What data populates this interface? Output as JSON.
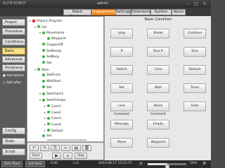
{
  "titlebar": {
    "logo": "ELITE ROBOT",
    "user": "admin"
  },
  "menu": [
    "Robot Teaching",
    "Programming",
    "Settings",
    "Extensions",
    "System Info",
    "About"
  ],
  "left": {
    "project": "Project",
    "procedure": "Procedure",
    "conditions": "Conditions",
    "basic": "Basic",
    "advanced": "Advanced",
    "peripheral": "Peripheral",
    "add_before": "Add before",
    "add_after": "Add after",
    "config": "Config",
    "state": "State",
    "script": "Script"
  },
  "tree": [
    {
      "label": "Project_Program",
      "icon": "square",
      "indent": 0,
      "tog": "▾"
    },
    {
      "label": "Init",
      "icon": "dot",
      "indent": 1,
      "tog": "▾"
    },
    {
      "label": "MoveHome",
      "icon": "dot",
      "indent": 2,
      "tog": "▾"
    },
    {
      "label": "Waypoint",
      "icon": "dot",
      "indent": 3,
      "tog": ""
    },
    {
      "label": "GripperOff",
      "icon": "dot",
      "indent": 2,
      "tog": ""
    },
    {
      "label": "SetReady",
      "icon": "dot",
      "indent": 2,
      "tog": ""
    },
    {
      "label": "SetBusy",
      "icon": "dot",
      "indent": 2,
      "tog": ""
    },
    {
      "label": "Set",
      "icon": "dot",
      "indent": 2,
      "tog": ""
    },
    {
      "label": "Main",
      "icon": "dot",
      "indent": 1,
      "tog": "▾"
    },
    {
      "label": "SetFinish",
      "icon": "dot",
      "indent": 2,
      "tog": ""
    },
    {
      "label": "WaitStart",
      "icon": "dot",
      "indent": 2,
      "tog": ""
    },
    {
      "label": "Set",
      "icon": "dot",
      "indent": 2,
      "tog": ""
    },
    {
      "label": "Switchpick",
      "icon": "dot",
      "indent": 2,
      "tog": "▾"
    },
    {
      "label": "Switchdrops",
      "icon": "dot",
      "indent": 2,
      "tog": "▾"
    },
    {
      "label": "Case1",
      "icon": "dot",
      "indent": 3,
      "tog": "▸"
    },
    {
      "label": "Case2",
      "icon": "dot",
      "indent": 3,
      "tog": "▸"
    },
    {
      "label": "Case3",
      "icon": "dot",
      "indent": 3,
      "tog": "▸"
    },
    {
      "label": "Case4",
      "icon": "dot",
      "indent": 3,
      "tog": "▸"
    },
    {
      "label": "Default",
      "icon": "dot",
      "indent": 3,
      "tog": "▸"
    },
    {
      "label": "Set",
      "icon": "dot",
      "indent": 2,
      "tog": ""
    }
  ],
  "tree_footer": {
    "move_limit": "Move Limit",
    "speed": "100%"
  },
  "tree_buttons": {
    "start": "Start",
    "step": "Step"
  },
  "conditions": {
    "title": "Basic Condition",
    "buttons": [
      "Loop",
      "Break",
      "Continue",
      "If",
      "Else If",
      "Else",
      "Switch",
      "Case",
      "Default",
      "Set",
      "Wait",
      "Timer",
      "Line Comment",
      "Block Comment",
      "Goto",
      "Message",
      "Empty",
      "",
      "Move",
      "Waypoint",
      ""
    ]
  },
  "status": {
    "zero_pose": "Zero Pose",
    "init_pose": "Init Pose",
    "value": "0.00",
    "mode": "Lv2",
    "datetime": "2022-08-17 12:41:57",
    "speed_label": "50%",
    "speed_fraction": 0.5
  }
}
